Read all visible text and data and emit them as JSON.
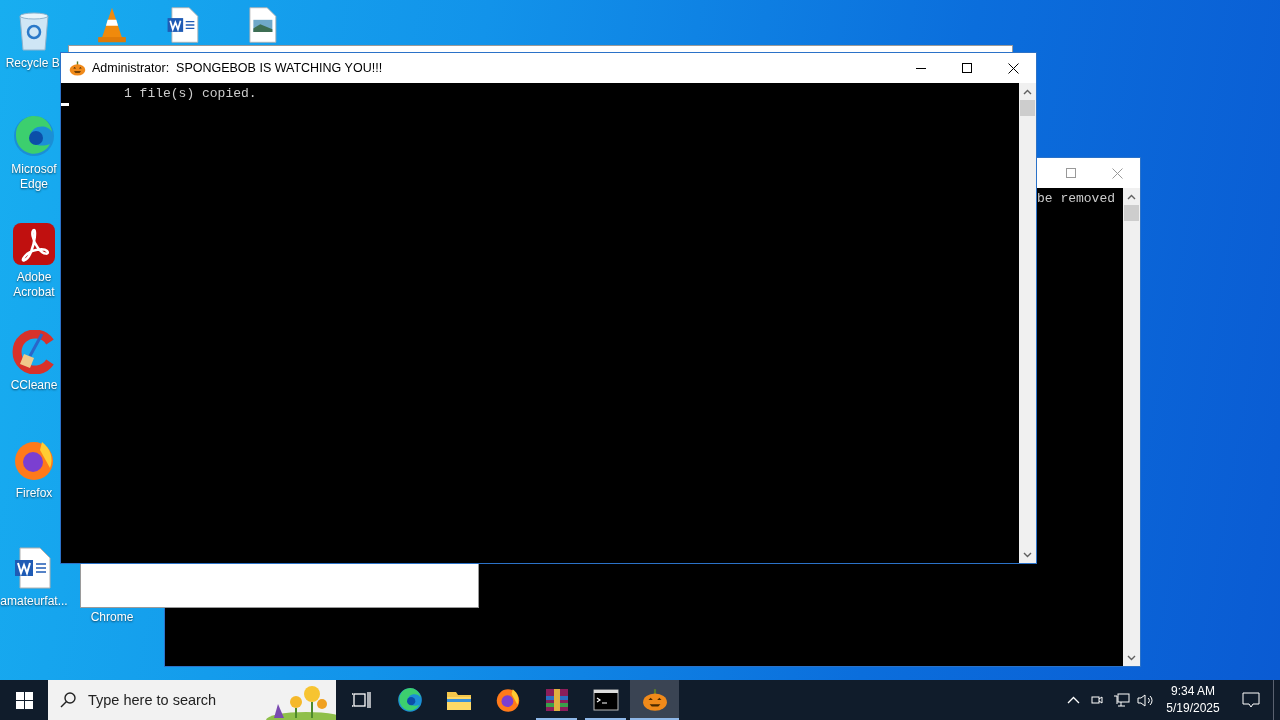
{
  "desktop_icons": [
    {
      "kind": "recycle-bin",
      "label": "Recycle Bi"
    },
    {
      "kind": "edge",
      "label": "Microsof\nEdge"
    },
    {
      "kind": "acrobat",
      "label": "Adobe\nAcrobat"
    },
    {
      "kind": "ccleaner",
      "label": "CCleane"
    },
    {
      "kind": "firefox",
      "label": "Firefox"
    },
    {
      "kind": "word",
      "label": "amateurfat..."
    },
    {
      "kind": "vlc"
    },
    {
      "kind": "word"
    },
    {
      "kind": "image"
    },
    {
      "kind": "label-only",
      "label": "Chrome"
    }
  ],
  "back_window": {
    "console_lines": [
      "be removed"
    ]
  },
  "front_window": {
    "title": "Administrator:  SPONGEBOB IS WATCHING YOU!!!",
    "console_lines": [
      "1 file(s) copied."
    ]
  },
  "taskbar": {
    "search": {
      "placeholder": "Type here to search"
    },
    "apps": [
      {
        "kind": "task-view",
        "running": false,
        "selected": false
      },
      {
        "kind": "edge",
        "running": false,
        "selected": false
      },
      {
        "kind": "explorer",
        "running": false,
        "selected": false
      },
      {
        "kind": "firefox",
        "running": false,
        "selected": false
      },
      {
        "kind": "winrar",
        "running": true,
        "selected": false
      },
      {
        "kind": "cmd",
        "running": true,
        "selected": false
      },
      {
        "kind": "pumpkin",
        "running": true,
        "selected": true
      }
    ],
    "clock": {
      "time": "9:34 AM",
      "date": "5/19/2025"
    }
  }
}
